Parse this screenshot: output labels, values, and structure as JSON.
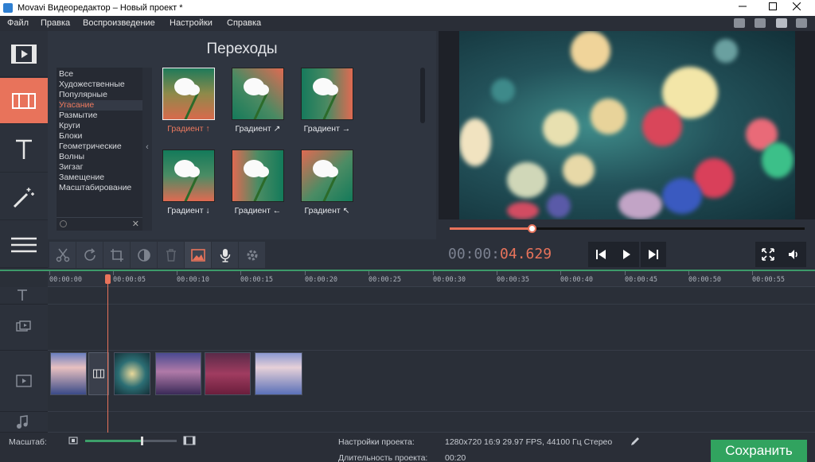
{
  "window": {
    "title": "Movavi Видеоредактор – Новый проект *",
    "controls": [
      "minimize-icon",
      "maximize-icon",
      "close-icon"
    ]
  },
  "menu": {
    "items": [
      "Файл",
      "Правка",
      "Воспроизведение",
      "Настройки",
      "Справка"
    ],
    "right_icons": [
      "store-icon",
      "share-icon",
      "vk-icon",
      "facebook-icon"
    ]
  },
  "left_toolbar": {
    "tools": [
      {
        "icon": "media-film-icon",
        "active": false
      },
      {
        "icon": "transitions-icon",
        "active": true
      },
      {
        "icon": "titles-icon",
        "active": false
      },
      {
        "icon": "magic-wand-icon",
        "active": false
      },
      {
        "icon": "menu-icon",
        "active": false
      }
    ]
  },
  "transitions": {
    "title": "Переходы",
    "categories": [
      "Все",
      "Художественные",
      "Популярные",
      "Угасание",
      "Размытие",
      "Круги",
      "Блоки",
      "Геометрические",
      "Волны",
      "Зигзаг",
      "Замещение",
      "Масштабирование"
    ],
    "selected_category": "Угасание",
    "collapse_glyph": "‹",
    "search_clear": "✕",
    "items": [
      {
        "label": "Градиент ↑",
        "selected": true
      },
      {
        "label": "Градиент ↗",
        "selected": false
      },
      {
        "label": "Градиент →",
        "selected": false
      },
      {
        "label": "Градиент ↓",
        "selected": false
      },
      {
        "label": "Градиент ←",
        "selected": false
      },
      {
        "label": "Градиент ↖",
        "selected": false
      }
    ]
  },
  "player": {
    "timecode_gray": "00:00:",
    "timecode_red": "04.629",
    "progress": 0.23,
    "buttons": [
      "skip-back-icon",
      "play-icon",
      "skip-forward-icon",
      "fullscreen-icon",
      "volume-icon"
    ]
  },
  "edit_toolbar": {
    "tools": [
      "scissors-icon",
      "rotate-icon",
      "crop-icon",
      "color-adjust-icon",
      "trash-icon",
      "image-icon",
      "microphone-icon",
      "gear-icon"
    ],
    "active": "image-icon"
  },
  "timeline": {
    "ruler": [
      "00:00:00",
      "00:00:05",
      "00:00:10",
      "00:00:15",
      "00:00:20",
      "00:00:25",
      "00:00:30",
      "00:00:35",
      "00:00:40",
      "00:00:45",
      "00:00:50",
      "00:00:55"
    ],
    "tracks": [
      "text-track-icon",
      "overlay-track-icon",
      "video-track-icon",
      "music-note-icon"
    ]
  },
  "status": {
    "scale_label": "Масштаб:",
    "zoom_level": 0.62,
    "project_settings_label": "Настройки проекта:",
    "project_settings_value": "1280x720 16:9 29.97 FPS, 44100 Гц Стерео",
    "duration_label": "Длительность проекта:",
    "duration_value": "00:20",
    "save_label": "Сохранить"
  },
  "colors": {
    "accent": "#e8735b",
    "save_green": "#31a35f",
    "panel_bg": "#2f3540"
  }
}
